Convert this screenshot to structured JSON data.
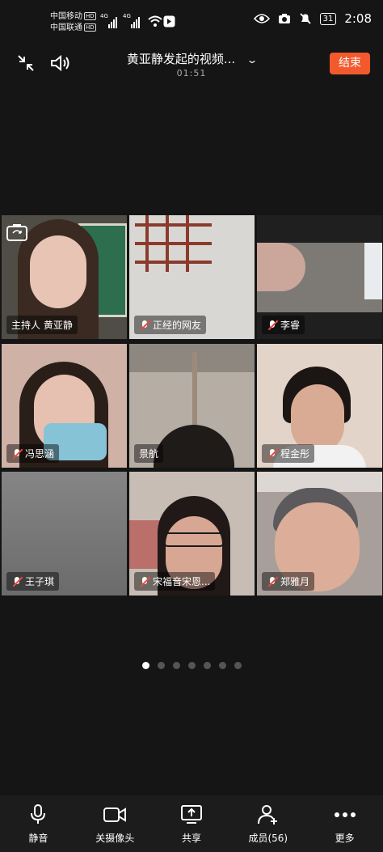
{
  "status_bar": {
    "carrier1": "中国移动",
    "carrier2": "中国联通",
    "hd": "HD",
    "net1": "4G",
    "net2": "4G",
    "battery": "31",
    "time": "2:08"
  },
  "call": {
    "title": "黄亚静发起的视频...",
    "timer": "01:51",
    "end_label": "结束"
  },
  "participants": [
    {
      "name": "主持人  黄亚静",
      "muted": false,
      "bg": "#5b5a52"
    },
    {
      "name": "正经的网友",
      "muted": true,
      "bg": "#d7d5d2"
    },
    {
      "name": "李睿",
      "muted": true,
      "bg": "#8b8782"
    },
    {
      "name": "冯思涵",
      "muted": true,
      "bg": "#c9a8a0"
    },
    {
      "name": "景航",
      "muted": false,
      "bg": "#a59d95"
    },
    {
      "name": "程金彤",
      "muted": true,
      "bg": "#d9c8bd"
    },
    {
      "name": "王子琪",
      "muted": true,
      "bg": "#767676"
    },
    {
      "name": "宋福音宋恩...",
      "muted": true,
      "bg": "#bdb4ad"
    },
    {
      "name": "郑雅月",
      "muted": true,
      "bg": "#9a8d88"
    }
  ],
  "pagination": {
    "pages": 7,
    "current": 1
  },
  "toolbar": {
    "mute": "静音",
    "camera": "关摄像头",
    "share": "共享",
    "members": "成员(56)",
    "more": "更多"
  }
}
